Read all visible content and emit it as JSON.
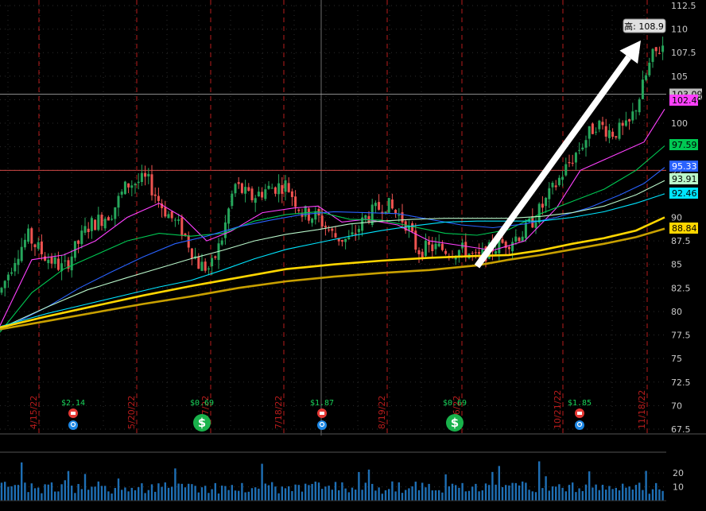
{
  "chart_data": {
    "type": "candlestick",
    "price_axis": {
      "ylim": [
        67.5,
        112.5
      ],
      "ticks": [
        "112.5",
        "110",
        "107.5",
        "105",
        "102.5",
        "100",
        "97.5",
        "95",
        "92.5",
        "90",
        "87.5",
        "85",
        "82.5",
        "80",
        "77.5",
        "75",
        "72.5",
        "70",
        "67.5"
      ],
      "grid": true
    },
    "volume_axis": {
      "ylim": [
        0,
        35
      ],
      "ticks": [
        "20",
        "10"
      ]
    },
    "date_labels": [
      "4/15/22",
      "5/20/22",
      "6/17/22",
      "7/18/22",
      "8/19/22",
      "9/16/22",
      "10/21/22",
      "11/18/22"
    ],
    "price_labels": {
      "high": "高: 108.9",
      "crosshair": "103.09",
      "ma_values": [
        {
          "text": "102.49",
          "bg": "#ff40ff",
          "fg": "#000000"
        },
        {
          "text": "97.59",
          "bg": "#00c853",
          "fg": "#000000"
        },
        {
          "text": "95.33",
          "bg": "#2962ff",
          "fg": "#ffffff"
        },
        {
          "text": "93.91",
          "bg": "#b9f6ca",
          "fg": "#000000"
        },
        {
          "text": "92.46",
          "bg": "#00e5ff",
          "fg": "#000000"
        },
        {
          "text": "88.84",
          "bg": "#ffd600",
          "fg": "#000000"
        }
      ]
    },
    "horizontal_lines": [
      {
        "value": 103.09,
        "color": "#9e9e9e"
      },
      {
        "value": 95.0,
        "color": "#ef5350"
      }
    ],
    "series": [
      {
        "kind": "ma",
        "color": "#ff40ff",
        "points": [
          [
            0,
            78.5
          ],
          [
            20,
            82
          ],
          [
            40,
            85.5
          ],
          [
            80,
            86
          ],
          [
            120,
            87.5
          ],
          [
            160,
            90
          ],
          [
            200,
            91.5
          ],
          [
            230,
            90
          ],
          [
            260,
            87.5
          ],
          [
            290,
            88.5
          ],
          [
            330,
            90.5
          ],
          [
            370,
            91
          ],
          [
            400,
            91.2
          ],
          [
            430,
            89.5
          ],
          [
            460,
            89.8
          ],
          [
            500,
            89.2
          ],
          [
            540,
            87.5
          ],
          [
            580,
            87
          ],
          [
            620,
            86.5
          ],
          [
            660,
            87.5
          ],
          [
            700,
            91
          ],
          [
            730,
            95
          ],
          [
            770,
            96.5
          ],
          [
            810,
            98
          ],
          [
            836,
            101.5
          ]
        ]
      },
      {
        "kind": "ma",
        "color": "#00c853",
        "points": [
          [
            0,
            77.8
          ],
          [
            40,
            82
          ],
          [
            80,
            84.5
          ],
          [
            120,
            86
          ],
          [
            160,
            87.5
          ],
          [
            200,
            88.3
          ],
          [
            240,
            88
          ],
          [
            280,
            88.3
          ],
          [
            320,
            89.6
          ],
          [
            360,
            90.3
          ],
          [
            400,
            90.6
          ],
          [
            440,
            89.8
          ],
          [
            480,
            89.7
          ],
          [
            520,
            89
          ],
          [
            560,
            88.3
          ],
          [
            600,
            88.1
          ],
          [
            640,
            88.7
          ],
          [
            680,
            90.4
          ],
          [
            720,
            91.7
          ],
          [
            760,
            93
          ],
          [
            800,
            95
          ],
          [
            836,
            97.6
          ]
        ]
      },
      {
        "kind": "ma",
        "color": "#2962ff",
        "points": [
          [
            0,
            78
          ],
          [
            60,
            80.5
          ],
          [
            100,
            82.5
          ],
          [
            140,
            84.2
          ],
          [
            180,
            85.8
          ],
          [
            220,
            87.2
          ],
          [
            260,
            88
          ],
          [
            300,
            89
          ],
          [
            340,
            89.7
          ],
          [
            380,
            90.3
          ],
          [
            420,
            90.6
          ],
          [
            460,
            90.5
          ],
          [
            500,
            90.4
          ],
          [
            540,
            89.8
          ],
          [
            580,
            89.2
          ],
          [
            620,
            88.9
          ],
          [
            660,
            89.3
          ],
          [
            700,
            90
          ],
          [
            740,
            91
          ],
          [
            780,
            92.4
          ],
          [
            810,
            93.6
          ],
          [
            836,
            95.3
          ]
        ]
      },
      {
        "kind": "ma",
        "color": "#b9f6ca",
        "points": [
          [
            0,
            78.2
          ],
          [
            60,
            80.5
          ],
          [
            110,
            82.3
          ],
          [
            160,
            83.6
          ],
          [
            200,
            84.6
          ],
          [
            240,
            85.6
          ],
          [
            280,
            86.5
          ],
          [
            320,
            87.5
          ],
          [
            360,
            88.2
          ],
          [
            400,
            88.7
          ],
          [
            440,
            89.3
          ],
          [
            480,
            89.6
          ],
          [
            520,
            89.8
          ],
          [
            560,
            89.9
          ],
          [
            600,
            89.9
          ],
          [
            640,
            89.9
          ],
          [
            680,
            90.1
          ],
          [
            720,
            90.5
          ],
          [
            760,
            91.2
          ],
          [
            800,
            92.4
          ],
          [
            836,
            93.9
          ]
        ]
      },
      {
        "kind": "ma",
        "color": "#00e5ff",
        "points": [
          [
            0,
            78.4
          ],
          [
            60,
            79.8
          ],
          [
            110,
            80.8
          ],
          [
            160,
            81.8
          ],
          [
            200,
            82.6
          ],
          [
            240,
            83.3
          ],
          [
            280,
            84.4
          ],
          [
            320,
            85.6
          ],
          [
            360,
            86.6
          ],
          [
            400,
            87.3
          ],
          [
            440,
            88
          ],
          [
            480,
            88.6
          ],
          [
            520,
            89.1
          ],
          [
            560,
            89.5
          ],
          [
            600,
            89.6
          ],
          [
            640,
            89.6
          ],
          [
            680,
            89.6
          ],
          [
            720,
            90
          ],
          [
            760,
            90.6
          ],
          [
            800,
            91.5
          ],
          [
            836,
            92.5
          ]
        ]
      },
      {
        "kind": "ma",
        "color": "#ffd600",
        "points": [
          [
            0,
            78.3
          ],
          [
            60,
            79.5
          ],
          [
            120,
            80.6
          ],
          [
            180,
            81.7
          ],
          [
            240,
            82.7
          ],
          [
            300,
            83.6
          ],
          [
            360,
            84.5
          ],
          [
            420,
            85
          ],
          [
            480,
            85.4
          ],
          [
            540,
            85.7
          ],
          [
            600,
            85.9
          ],
          [
            640,
            86
          ],
          [
            680,
            86.5
          ],
          [
            720,
            87.2
          ],
          [
            760,
            87.8
          ],
          [
            800,
            88.6
          ],
          [
            836,
            90
          ]
        ]
      },
      {
        "kind": "ma",
        "color": "#c8a000",
        "points": [
          [
            0,
            78.1
          ],
          [
            60,
            79
          ],
          [
            120,
            79.9
          ],
          [
            180,
            80.8
          ],
          [
            240,
            81.6
          ],
          [
            300,
            82.5
          ],
          [
            360,
            83.2
          ],
          [
            420,
            83.7
          ],
          [
            480,
            84.1
          ],
          [
            540,
            84.4
          ],
          [
            600,
            84.9
          ],
          [
            640,
            85.5
          ],
          [
            680,
            86
          ],
          [
            720,
            86.6
          ],
          [
            760,
            87.2
          ],
          [
            800,
            87.9
          ],
          [
            836,
            88.8
          ]
        ]
      }
    ],
    "candles_note": "daily OHLC candles, Apr–Nov 2022",
    "annotations": {
      "arrow": {
        "from": [
          600,
          84.8
        ],
        "to": [
          806,
          108.8
        ],
        "color": "#ffffff"
      },
      "events": [
        {
          "text": "$2.14",
          "x": 92,
          "kind": "dividend"
        },
        {
          "text": "$0.69",
          "x": 254,
          "kind": "dollar"
        },
        {
          "text": "$1.87",
          "x": 405,
          "kind": "dividend"
        },
        {
          "text": "$0.69",
          "x": 572,
          "kind": "dollar"
        },
        {
          "text": "$1.85",
          "x": 729,
          "kind": "dividend"
        }
      ]
    }
  }
}
